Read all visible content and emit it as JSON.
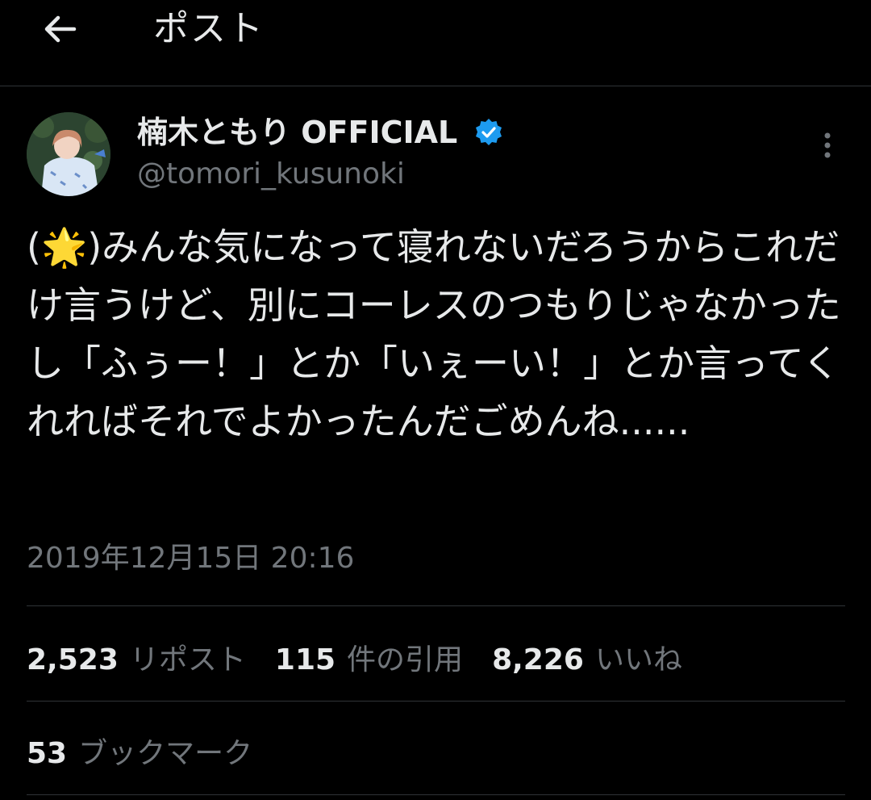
{
  "header": {
    "title": "ポスト",
    "back_icon": "arrow-left-icon"
  },
  "author": {
    "display_name": "楠木ともり OFFICIAL",
    "handle": "@tomori_kusunoki",
    "verified": true,
    "verified_color": "#1d9bf0"
  },
  "tweet": {
    "text": "(🌟)みんな気になって寝れないだろうからこれだけ言うけど、別にコーレスのつもりじゃなかったし「ふぅー！」とか「いぇーい！」とか言ってくれればそれでよかったんだごめんね......",
    "timestamp": "2019年12月15日 20:16"
  },
  "stats": {
    "reposts": {
      "count": "2,523",
      "label": "リポスト"
    },
    "quotes": {
      "count": "115",
      "label": "件の引用"
    },
    "likes": {
      "count": "8,226",
      "label": "いいね"
    },
    "bookmarks": {
      "count": "53",
      "label": "ブックマーク"
    }
  },
  "colors": {
    "background": "#000000",
    "text_primary": "#e7e9ea",
    "text_secondary": "#71767b",
    "divider": "#2f3336"
  }
}
